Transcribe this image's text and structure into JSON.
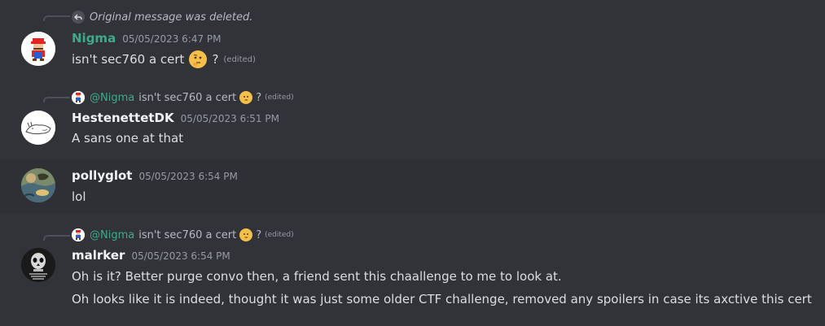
{
  "colors": {
    "background": "#313338",
    "hover_background": "#2e3035",
    "username_teal": "#3fa989",
    "text": "#dbdee1",
    "muted": "#949ba4"
  },
  "messages": [
    {
      "reply_notice": "Original message was deleted.",
      "reply_icon": "reply-arrow-icon",
      "username": "Nigma",
      "timestamp": "05/05/2023 6:47 PM",
      "avatar": "mario-avatar",
      "text": "isn't sec760 a cert",
      "emoji": "thinking-face-emoji",
      "suffix": "?",
      "edited": "(edited)"
    },
    {
      "reply": {
        "mention": "@Nigma",
        "text": "isn't sec760 a cert",
        "suffix": "?",
        "edited": "(edited)"
      },
      "username": "HestenettetDK",
      "timestamp": "05/05/2023 6:51 PM",
      "avatar": "horse-sketch-avatar",
      "text": "A sans one at that"
    },
    {
      "username": "pollyglot",
      "timestamp": "05/05/2023 6:54 PM",
      "avatar": "painting-avatar",
      "text": "lol"
    },
    {
      "reply": {
        "mention": "@Nigma",
        "text": "isn't sec760 a cert",
        "suffix": "?",
        "edited": "(edited)"
      },
      "username": "malrker",
      "timestamp": "05/05/2023 6:54 PM",
      "avatar": "skull-avatar",
      "lines": [
        "Oh is it? Better purge convo then, a friend sent this chaallenge to me to look at.",
        "Oh looks like it is indeed, thought it was just some older CTF challenge, removed any spoilers in case its axctive this cert"
      ]
    }
  ]
}
